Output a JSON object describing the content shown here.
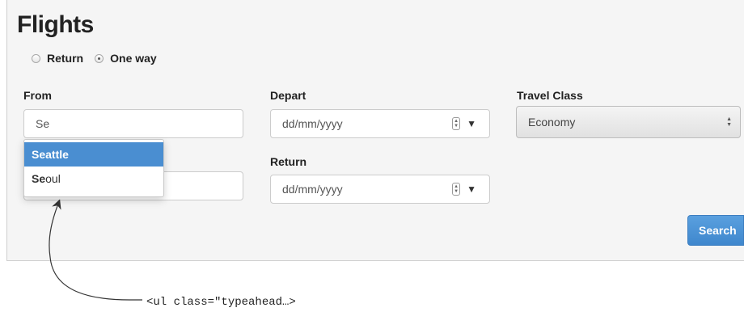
{
  "header": {
    "title": "Flights"
  },
  "trip_type": {
    "options": [
      {
        "label": "Return",
        "checked": false
      },
      {
        "label": "One way",
        "checked": true
      }
    ]
  },
  "from": {
    "label": "From",
    "value": "Se"
  },
  "depart": {
    "label": "Depart",
    "placeholder": "dd/mm/yyyy"
  },
  "return": {
    "label": "Return",
    "placeholder": "dd/mm/yyyy"
  },
  "travel_class": {
    "label": "Travel Class",
    "value": "Economy"
  },
  "typeahead": {
    "items": [
      {
        "match": "Se",
        "rest": "attle",
        "active": true
      },
      {
        "match": "Se",
        "rest": "oul",
        "active": false
      }
    ]
  },
  "actions": {
    "search_label": "Search"
  },
  "annotation": {
    "text": "<ul class=\"typeahead…>"
  },
  "colors": {
    "accent": "#4a8ed1",
    "button": "#428bca"
  },
  "icons": {
    "stepper": "stepper-icon",
    "caret": "caret-down-icon",
    "select_arrows": "select-arrows-icon"
  }
}
